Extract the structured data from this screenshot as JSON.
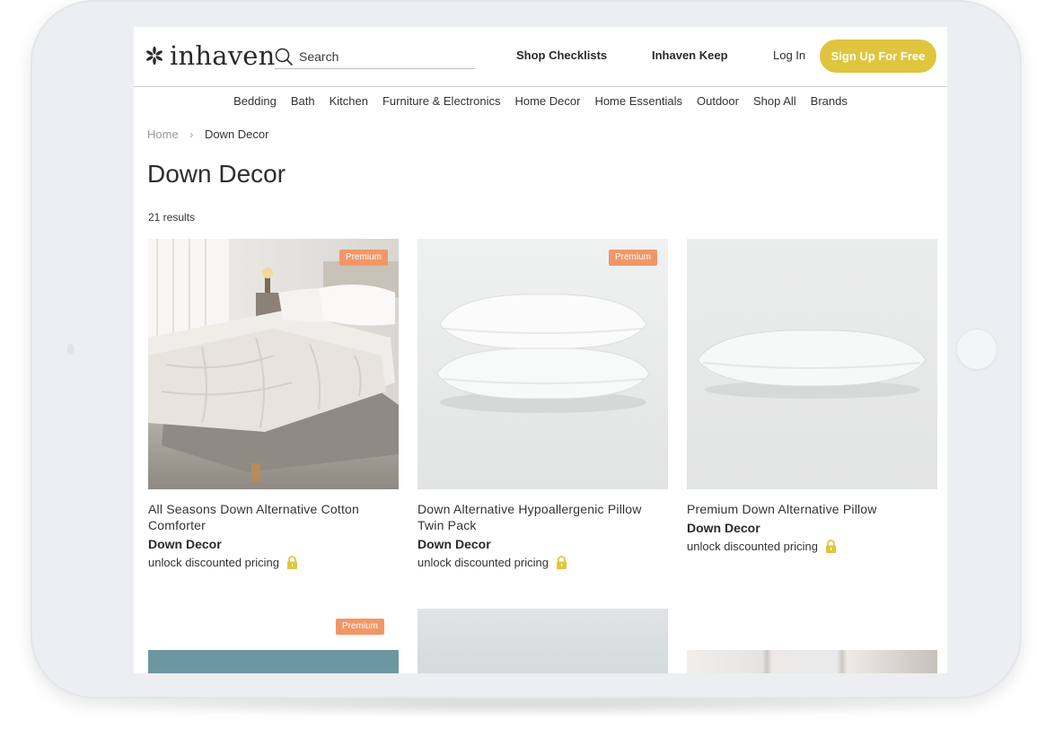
{
  "header": {
    "logo_text": "inhaven",
    "search_placeholder": "Search",
    "shop_checklists": "Shop Checklists",
    "inhaven_keep": "Inhaven Keep",
    "login": "Log In",
    "signup": "Sign Up For Free",
    "accent_color": "#e0c53e"
  },
  "categories": [
    "Bedding",
    "Bath",
    "Kitchen",
    "Furniture & Electronics",
    "Home Decor",
    "Home Essentials",
    "Outdoor",
    "Shop All",
    "Brands"
  ],
  "breadcrumb": {
    "home": "Home",
    "current": "Down Decor"
  },
  "page": {
    "title": "Down Decor",
    "results": "21 results"
  },
  "products": [
    {
      "name": "All Seasons Down Alternative Cotton Comforter",
      "brand": "Down Decor",
      "price_text": "unlock discounted pricing",
      "badge": "Premium",
      "image": "comforter-on-bed"
    },
    {
      "name": "Down Alternative Hypoallergenic Pillow Twin Pack",
      "brand": "Down Decor",
      "price_text": "unlock discounted pricing",
      "badge": "Premium",
      "image": "two-stacked-pillows"
    },
    {
      "name": "Premium Down Alternative Pillow",
      "brand": "Down Decor",
      "price_text": "unlock discounted pricing",
      "badge": "",
      "image": "single-pillow"
    }
  ],
  "row2": {
    "badge": "Premium"
  },
  "colors": {
    "badge": "#f19766",
    "lock": "#e0c53e"
  }
}
